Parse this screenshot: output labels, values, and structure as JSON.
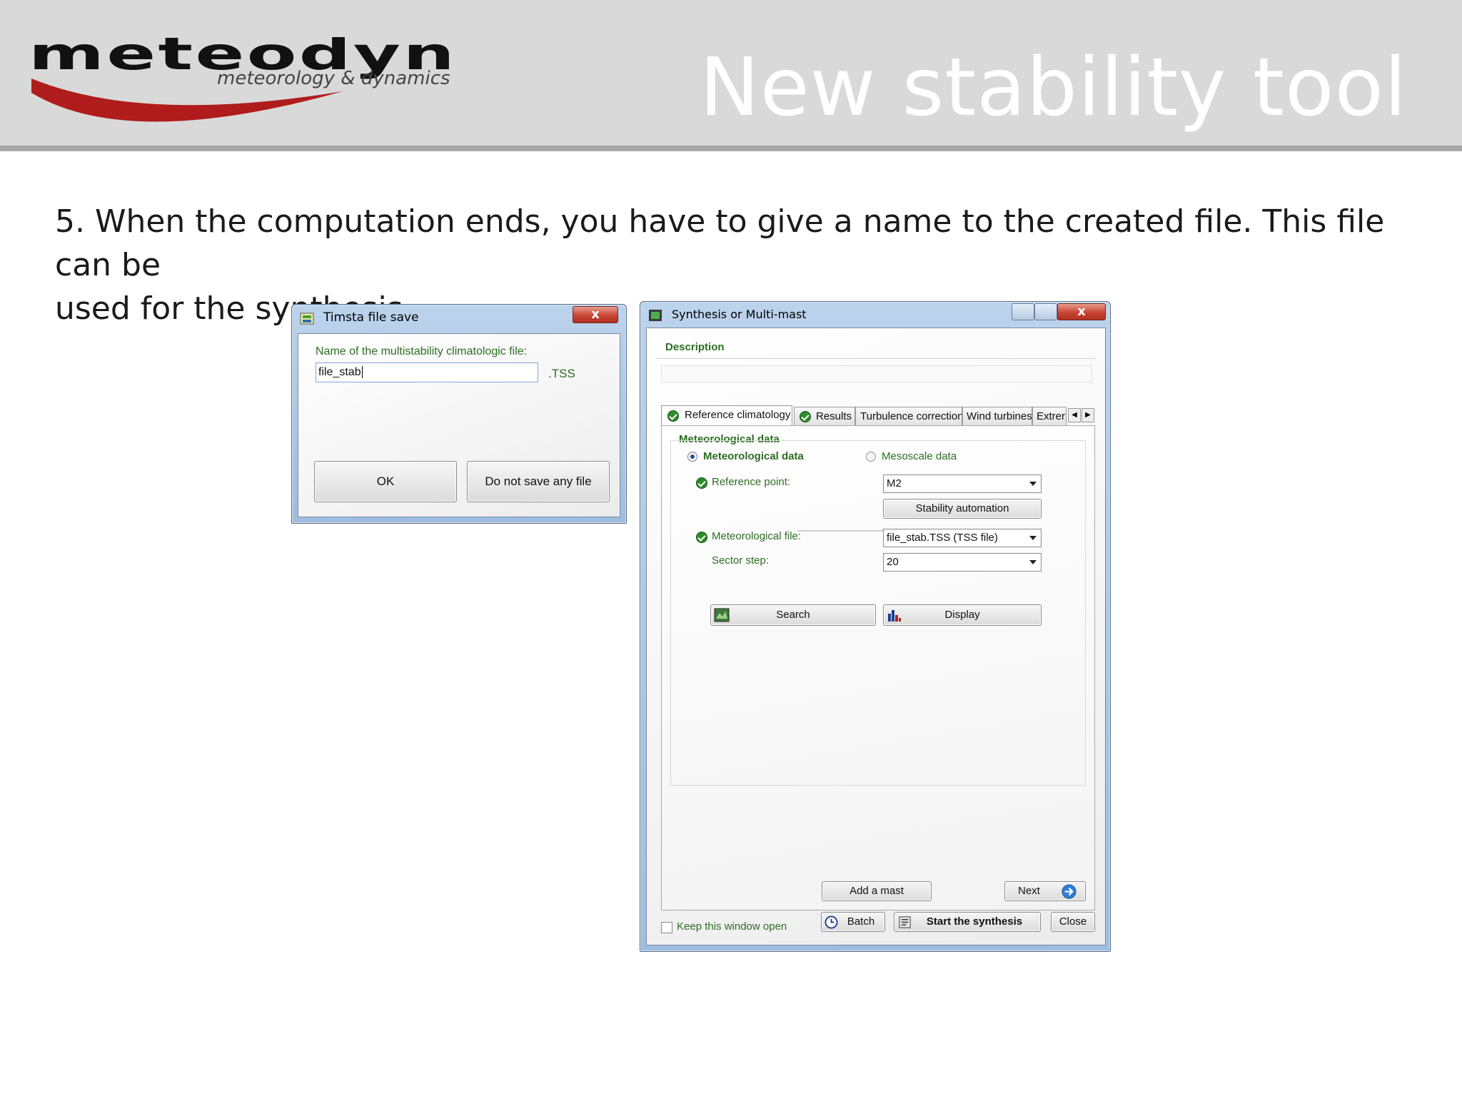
{
  "header": {
    "logo_name": "meteodyn",
    "logo_tagline": "meteorology & dynamics",
    "title": "New stability tool"
  },
  "body": {
    "line1": "5. When the computation ends, you have to give a name to the created file. This file can be",
    "line2": "used for the synthesis."
  },
  "timsta_dialog": {
    "title": "Timsta file save",
    "close_label": "x",
    "field_label": "Name of the multistability climatologic file:",
    "field_value": "file_stab",
    "extension": ".TSS",
    "ok_label": "OK",
    "no_save_label": "Do not save any file"
  },
  "synthesis_window": {
    "title": "Synthesis or Multi-mast",
    "close_label": "x",
    "description_label": "Description",
    "tabs": [
      {
        "label": "Reference climatology"
      },
      {
        "label": "Results"
      },
      {
        "label": "Turbulence correction"
      },
      {
        "label": "Wind turbines"
      },
      {
        "label": "Extrer"
      }
    ],
    "group_title": "Meteorological data",
    "radio_meteo": "Meteorological data",
    "radio_mesoscale": "Mesoscale data",
    "reference_point_label": "Reference point:",
    "reference_point_value": "M2",
    "stability_button": "Stability automation",
    "met_file_label": "Meteorological file:",
    "met_file_value": "file_stab.TSS (TSS file)",
    "sector_step_label": "Sector step:",
    "sector_step_value": "20",
    "search_button": "Search",
    "display_button": "Display",
    "add_mast_button": "Add a mast",
    "next_button": "Next",
    "keep_open_label": "Keep this window open",
    "batch_button": "Batch",
    "start_button": "Start the synthesis",
    "close_button": "Close"
  },
  "colors": {
    "header_bg": "#d9d9d9",
    "logo_red": "#b01c1c",
    "label_green": "#2c6e21"
  }
}
